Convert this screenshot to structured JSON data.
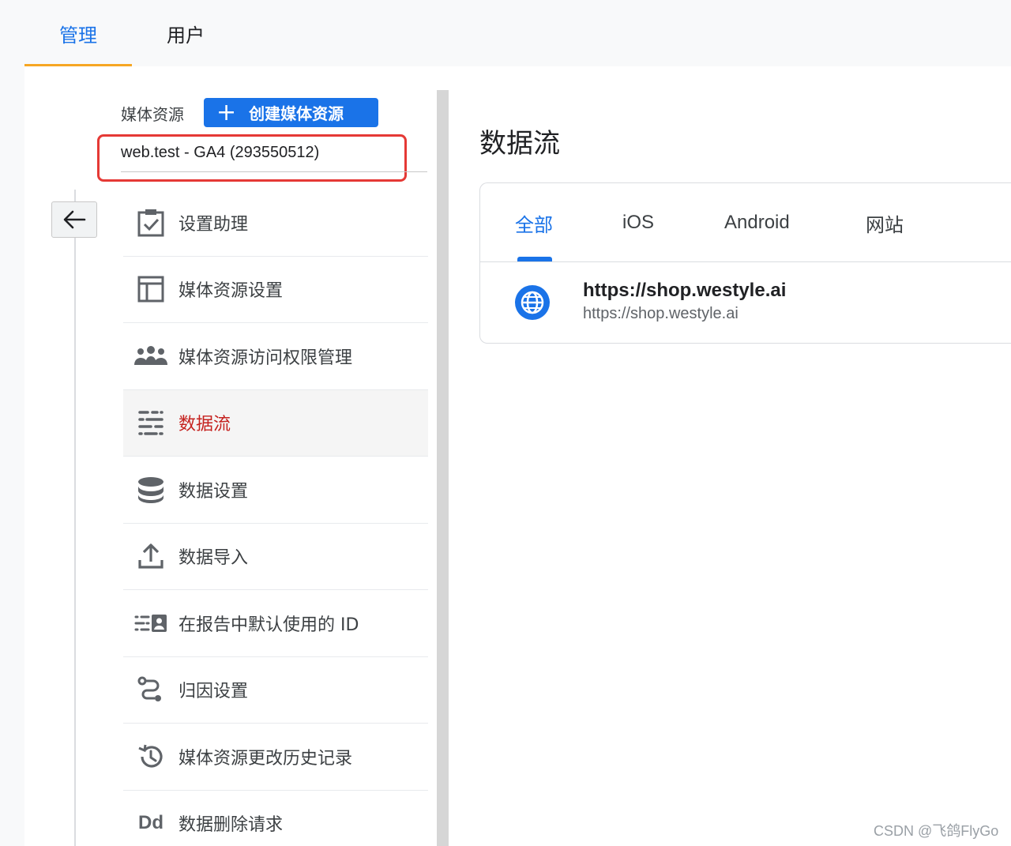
{
  "top_tabs": [
    {
      "label": "管理",
      "active": true
    },
    {
      "label": "用户",
      "active": false
    }
  ],
  "property": {
    "label": "媒体资源",
    "create_button": "创建媒体资源",
    "selected": "web.test - GA4 (293550512)"
  },
  "nav": {
    "items": [
      {
        "label": "设置助理",
        "icon": "clipboard-check-icon"
      },
      {
        "label": "媒体资源设置",
        "icon": "window-layout-icon"
      },
      {
        "label": "媒体资源访问权限管理",
        "icon": "people-icon"
      },
      {
        "label": "数据流",
        "icon": "data-streams-icon",
        "active": true
      },
      {
        "label": "数据设置",
        "icon": "database-icon"
      },
      {
        "label": "数据导入",
        "icon": "upload-icon"
      },
      {
        "label": "在报告中默认使用的 ID",
        "icon": "reporting-identity-icon"
      },
      {
        "label": "归因设置",
        "icon": "attribution-path-icon"
      },
      {
        "label": "媒体资源更改历史记录",
        "icon": "history-icon"
      },
      {
        "label": "数据删除请求",
        "icon": "data-deletion-icon",
        "glyph": "Dd"
      }
    ]
  },
  "main": {
    "title": "数据流",
    "tabs": [
      {
        "label": "全部",
        "active": true
      },
      {
        "label": "iOS",
        "active": false
      },
      {
        "label": "Android",
        "active": false
      },
      {
        "label": "网站",
        "active": false
      }
    ],
    "streams": [
      {
        "title": "https://shop.westyle.ai",
        "url": "https://shop.westyle.ai",
        "icon": "globe-icon"
      }
    ]
  },
  "watermark": "CSDN @飞鸽FlyGo",
  "colors": {
    "accent": "#1a73e8",
    "active_nav": "#c5221f",
    "highlight_border": "#e53935",
    "tab_underline": "#f6a623"
  }
}
